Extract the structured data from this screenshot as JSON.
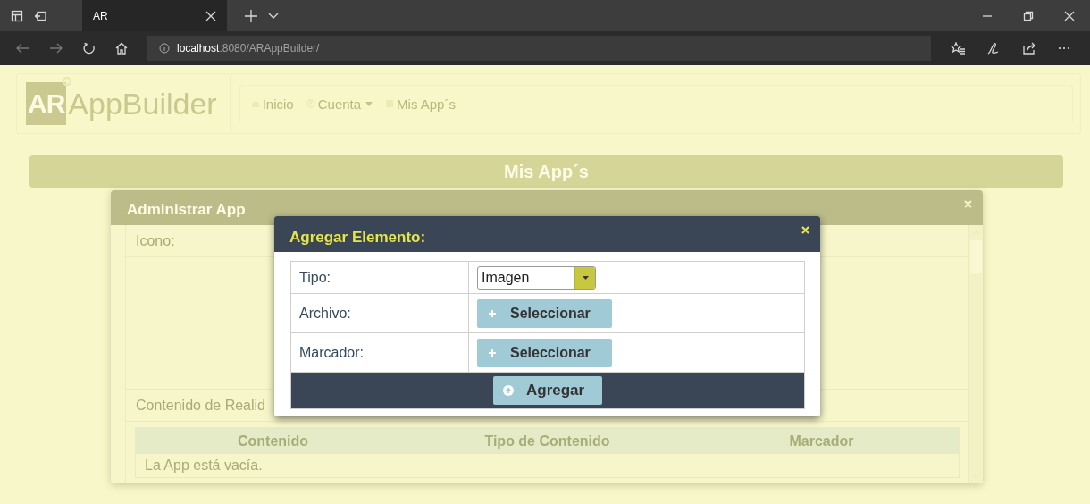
{
  "browser": {
    "tab": {
      "title": "AR"
    },
    "address": {
      "host": "localhost",
      "path": ":8080/ARAppBuilder/"
    }
  },
  "navbar": {
    "logo": {
      "mark": "AR",
      "name": "AppBuilder"
    },
    "items": [
      {
        "label": "Inicio",
        "dropdown": false
      },
      {
        "label": "Cuenta",
        "dropdown": true
      },
      {
        "label": "Mis App´s",
        "dropdown": false
      }
    ]
  },
  "page_title": "Mis App´s",
  "admin_modal": {
    "title": "Administrar App",
    "fields": [
      {
        "label": "Icono:"
      }
    ],
    "section": "Contenido de Realid",
    "table": {
      "columns": [
        "Contenido",
        "Tipo de Contenido",
        "Marcador"
      ],
      "empty_text": "La App está vacía."
    }
  },
  "add_modal": {
    "title": "Agregar Elemento:",
    "rows": [
      {
        "label": "Tipo:",
        "kind": "select",
        "value": "Imagen"
      },
      {
        "label": "Archivo:",
        "kind": "button",
        "button": "Seleccionar"
      },
      {
        "label": "Marcador:",
        "kind": "button",
        "button": "Seleccionar"
      }
    ],
    "submit": "Agregar"
  }
}
